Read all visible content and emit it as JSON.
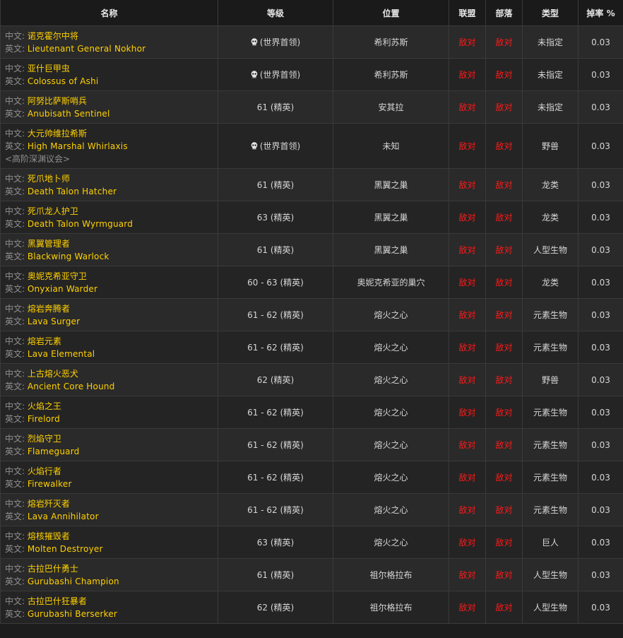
{
  "headers": [
    "名称",
    "等级",
    "位置",
    "联盟",
    "部落",
    "类型",
    "掉率 %"
  ],
  "labels": {
    "cn": "中文: ",
    "en": "英文: "
  },
  "rows": [
    {
      "cn": "诺克霍尔中将",
      "en": "Lieutenant General Nokhor",
      "level": "(世界首领)",
      "boss": true,
      "location": "希利苏斯",
      "alliance": "敌对",
      "horde": "敌对",
      "type": "未指定",
      "drop": "0.03"
    },
    {
      "cn": "亚什巨甲虫",
      "en": "Colossus of Ashi",
      "level": "(世界首领)",
      "boss": true,
      "location": "希利苏斯",
      "alliance": "敌对",
      "horde": "敌对",
      "type": "未指定",
      "drop": "0.03"
    },
    {
      "cn": "阿努比萨斯哨兵",
      "en": "Anubisath Sentinel",
      "level": "61 (精英)",
      "location": "安其拉",
      "alliance": "敌对",
      "horde": "敌对",
      "type": "未指定",
      "drop": "0.03"
    },
    {
      "cn": "大元帅维拉希斯",
      "en": "High Marshal Whirlaxis",
      "sub": "<高阶深渊议会>",
      "level": "(世界首领)",
      "boss": true,
      "location": "未知",
      "alliance": "敌对",
      "horde": "敌对",
      "type": "野兽",
      "drop": "0.03"
    },
    {
      "cn": "死爪地卜师",
      "en": "Death Talon Hatcher",
      "level": "61 (精英)",
      "location": "黑翼之巢",
      "alliance": "敌对",
      "horde": "敌对",
      "type": "龙类",
      "drop": "0.03"
    },
    {
      "cn": "死爪龙人护卫",
      "en": "Death Talon Wyrmguard",
      "level": "63 (精英)",
      "location": "黑翼之巢",
      "alliance": "敌对",
      "horde": "敌对",
      "type": "龙类",
      "drop": "0.03"
    },
    {
      "cn": "黑翼管理者",
      "en": "Blackwing Warlock",
      "level": "61 (精英)",
      "location": "黑翼之巢",
      "alliance": "敌对",
      "horde": "敌对",
      "type": "人型生物",
      "drop": "0.03"
    },
    {
      "cn": "奥妮克希亚守卫",
      "en": "Onyxian Warder",
      "level": "60 - 63 (精英)",
      "location": "奥妮克希亚的巢穴",
      "alliance": "敌对",
      "horde": "敌对",
      "type": "龙类",
      "drop": "0.03"
    },
    {
      "cn": "熔岩奔腾者",
      "en": "Lava Surger",
      "level": "61 - 62 (精英)",
      "location": "熔火之心",
      "alliance": "敌对",
      "horde": "敌对",
      "type": "元素生物",
      "drop": "0.03"
    },
    {
      "cn": "熔岩元素",
      "en": "Lava Elemental",
      "level": "61 - 62 (精英)",
      "location": "熔火之心",
      "alliance": "敌对",
      "horde": "敌对",
      "type": "元素生物",
      "drop": "0.03"
    },
    {
      "cn": "上古熔火恶犬",
      "en": "Ancient Core Hound",
      "level": "62 (精英)",
      "location": "熔火之心",
      "alliance": "敌对",
      "horde": "敌对",
      "type": "野兽",
      "drop": "0.03"
    },
    {
      "cn": "火焰之王",
      "en": "Firelord",
      "level": "61 - 62 (精英)",
      "location": "熔火之心",
      "alliance": "敌对",
      "horde": "敌对",
      "type": "元素生物",
      "drop": "0.03"
    },
    {
      "cn": "烈焰守卫",
      "en": "Flameguard",
      "level": "61 - 62 (精英)",
      "location": "熔火之心",
      "alliance": "敌对",
      "horde": "敌对",
      "type": "元素生物",
      "drop": "0.03"
    },
    {
      "cn": "火焰行者",
      "en": "Firewalker",
      "level": "61 - 62 (精英)",
      "location": "熔火之心",
      "alliance": "敌对",
      "horde": "敌对",
      "type": "元素生物",
      "drop": "0.03"
    },
    {
      "cn": "熔岩歼灭者",
      "en": "Lava Annihilator",
      "level": "61 - 62 (精英)",
      "location": "熔火之心",
      "alliance": "敌对",
      "horde": "敌对",
      "type": "元素生物",
      "drop": "0.03"
    },
    {
      "cn": "熔核摧毁者",
      "en": "Molten Destroyer",
      "level": "63 (精英)",
      "location": "熔火之心",
      "alliance": "敌对",
      "horde": "敌对",
      "type": "巨人",
      "drop": "0.03"
    },
    {
      "cn": "古拉巴什勇士",
      "en": "Gurubashi Champion",
      "level": "61 (精英)",
      "location": "祖尔格拉布",
      "alliance": "敌对",
      "horde": "敌对",
      "type": "人型生物",
      "drop": "0.03"
    },
    {
      "cn": "古拉巴什狂暴者",
      "en": "Gurubashi Berserker",
      "level": "62 (精英)",
      "location": "祖尔格拉布",
      "alliance": "敌对",
      "horde": "敌对",
      "type": "人型生物",
      "drop": "0.03"
    }
  ]
}
